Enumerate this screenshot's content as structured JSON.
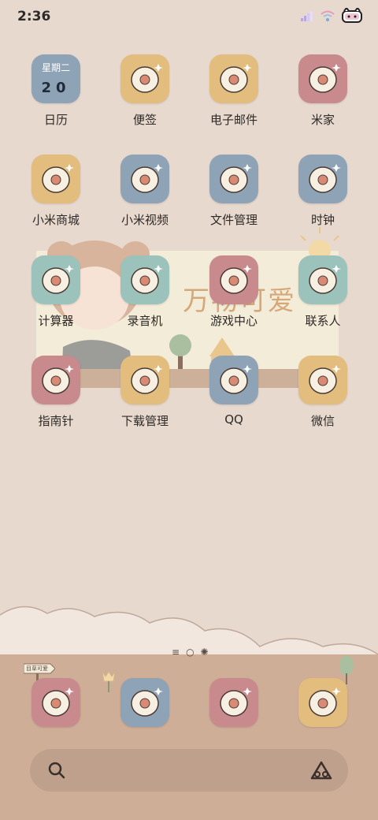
{
  "status": {
    "time": "2:36"
  },
  "wallpaper": {
    "banner": "万物可爱",
    "sign": "目草可爱"
  },
  "apps": [
    {
      "label": "日历",
      "icon": "calendar-icon",
      "color": "#8fa3b7",
      "week": "星期二",
      "day": "20"
    },
    {
      "label": "便签",
      "icon": "notes-icon",
      "color": "#e2bd7e"
    },
    {
      "label": "电子邮件",
      "icon": "email-icon",
      "color": "#e2bd7e"
    },
    {
      "label": "米家",
      "icon": "mijia-icon",
      "color": "#c98a8e"
    },
    {
      "label": "小米商城",
      "icon": "mi-store-icon",
      "color": "#e2bd7e"
    },
    {
      "label": "小米视频",
      "icon": "mi-video-icon",
      "color": "#8fa3b7"
    },
    {
      "label": "文件管理",
      "icon": "file-manager-icon",
      "color": "#8fa3b7"
    },
    {
      "label": "时钟",
      "icon": "clock-icon",
      "color": "#8fa3b7"
    },
    {
      "label": "计算器",
      "icon": "calculator-icon",
      "color": "#9cc3bb"
    },
    {
      "label": "录音机",
      "icon": "recorder-icon",
      "color": "#9cc3bb"
    },
    {
      "label": "游戏中心",
      "icon": "game-center-icon",
      "color": "#c98a8e"
    },
    {
      "label": "联系人",
      "icon": "contacts-icon",
      "color": "#9cc3bb"
    },
    {
      "label": "指南针",
      "icon": "compass-icon",
      "color": "#c98a8e"
    },
    {
      "label": "下载管理",
      "icon": "download-manager-icon",
      "color": "#e2bd7e"
    },
    {
      "label": "QQ",
      "icon": "qq-icon",
      "color": "#8fa3b7"
    },
    {
      "label": "微信",
      "icon": "wechat-icon",
      "color": "#e2bd7e"
    }
  ],
  "dock": [
    {
      "icon": "phone-icon",
      "color": "#c98a8e"
    },
    {
      "icon": "browser-icon",
      "color": "#8fa3b7"
    },
    {
      "icon": "camera-icon",
      "color": "#c98a8e"
    },
    {
      "icon": "gallery-icon",
      "color": "#e2bd7e"
    }
  ]
}
